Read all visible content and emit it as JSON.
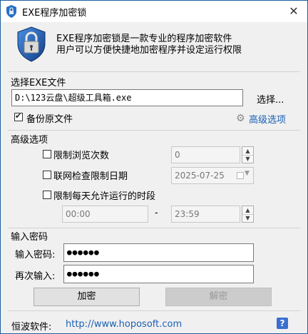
{
  "window": {
    "title": "EXE程序加密锁",
    "close_glyph": "✕"
  },
  "intro": {
    "line1": "EXE程序加密锁是一款专业的程序加密软件",
    "line2": "用户可以方便快捷地加密程序并设定运行权限"
  },
  "file_section": {
    "title": "选择EXE文件",
    "path_value": "D:\\123云盘\\超级工具箱.exe",
    "browse_label": "选择...",
    "backup_label": "备份原文件",
    "backup_checked": true,
    "advanced_link": "高级选项"
  },
  "advanced_section": {
    "title": "高级选项",
    "limit_views_label": "限制浏览次数",
    "views_value": "0",
    "net_date_label": "联网检查限制日期",
    "date_value": "2025-07-25",
    "daily_time_label": "限制每天允许运行的时段",
    "time_start": "00:00",
    "time_dash": "-",
    "time_end": "23:59"
  },
  "password_section": {
    "title": "输入密码",
    "password_label": "输入密码:",
    "password_value": "●●●●●●",
    "confirm_label": "再次输入:",
    "confirm_value": "●●●●●●",
    "encrypt_label": "加密",
    "decrypt_label": "解密"
  },
  "footer": {
    "label": "恒波软件:",
    "url": "http://www.hoposoft.com",
    "help_glyph": "?"
  }
}
